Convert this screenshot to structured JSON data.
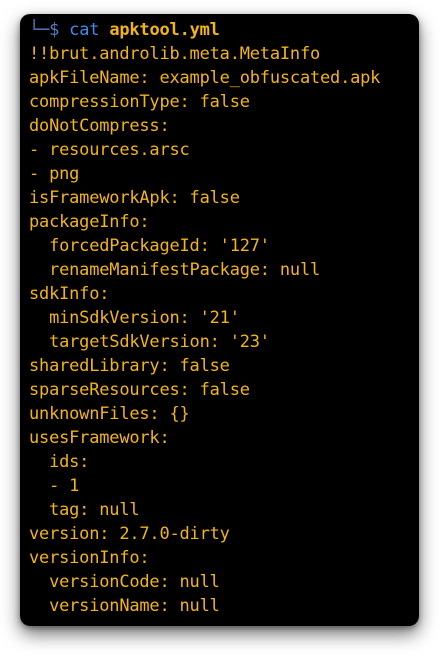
{
  "prompt": {
    "corner": "└─",
    "dollar": "$",
    "command": "cat",
    "argument": "apktool.yml"
  },
  "output_lines": [
    "!!brut.androlib.meta.MetaInfo",
    "apkFileName: example_obfuscated.apk",
    "compressionType: false",
    "doNotCompress:",
    "- resources.arsc",
    "- png",
    "isFrameworkApk: false",
    "packageInfo:",
    "  forcedPackageId: '127'",
    "  renameManifestPackage: null",
    "sdkInfo:",
    "  minSdkVersion: '21'",
    "  targetSdkVersion: '23'",
    "sharedLibrary: false",
    "sparseResources: false",
    "unknownFiles: {}",
    "usesFramework:",
    "  ids:",
    "  - 1",
    "  tag: null",
    "version: 2.7.0-dirty",
    "versionInfo:",
    "  versionCode: null",
    "  versionName: null"
  ],
  "colors": {
    "background": "#000000",
    "output_text": "#f3b512",
    "prompt": "#4f7fc9",
    "command": "#3c8df0"
  }
}
